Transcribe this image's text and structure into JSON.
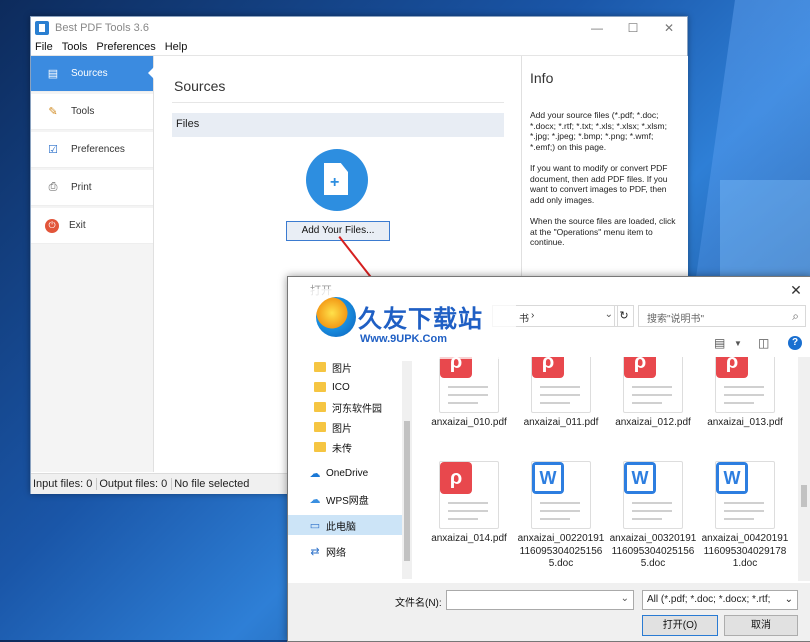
{
  "app": {
    "title": "Best PDF Tools 3.6",
    "menu": [
      "File",
      "Tools",
      "Preferences",
      "Help"
    ],
    "nav": [
      {
        "label": "Sources",
        "icon": "sources-icon"
      },
      {
        "label": "Tools",
        "icon": "tools-icon"
      },
      {
        "label": "Preferences",
        "icon": "preferences-icon"
      },
      {
        "label": "Print",
        "icon": "printer-icon"
      },
      {
        "label": "Exit",
        "icon": "power-icon"
      }
    ],
    "main": {
      "heading": "Sources",
      "files_label": "Files",
      "add_button": "Add Your Files..."
    },
    "info": {
      "title": "Info",
      "p1": "Add your source files (*.pdf; *.doc; *.docx; *.rtf; *.txt; *.xls; *.xlsx; *.xlsm; *.jpg; *.jpeg; *.bmp; *.png; *.wmf; *.emf;) on this page.",
      "p2": "If you want to modify or convert PDF document, then add PDF files. If you want to convert images to PDF, then add only images.",
      "p3": "When the source files are loaded, click at the \"Operations\" menu item to continue."
    },
    "status": {
      "input": "Input files: 0",
      "output": "Output files: 0",
      "selection": "No file selected"
    }
  },
  "dialog": {
    "title": "打开",
    "address": "书",
    "search_placeholder": "搜索\"说明书\"",
    "nav_items": [
      {
        "label": "图片",
        "type": "folder"
      },
      {
        "label": "ICO",
        "type": "folder"
      },
      {
        "label": "河东软件园",
        "type": "folder"
      },
      {
        "label": "图片",
        "type": "folder"
      },
      {
        "label": "未传",
        "type": "folder"
      },
      {
        "label": "OneDrive",
        "type": "cloud"
      },
      {
        "label": "WPS网盘",
        "type": "cloud"
      },
      {
        "label": "此电脑",
        "type": "pc"
      },
      {
        "label": "网络",
        "type": "network"
      }
    ],
    "files": [
      {
        "name": "anxaizai_010.pdf",
        "kind": "pdf"
      },
      {
        "name": "anxaizai_011.pdf",
        "kind": "pdf"
      },
      {
        "name": "anxaizai_012.pdf",
        "kind": "pdf"
      },
      {
        "name": "anxaizai_013.pdf",
        "kind": "pdf"
      },
      {
        "name": "anxaizai_014.pdf",
        "kind": "pdf"
      },
      {
        "name": "anxaizai_00220191116095304025​1565.doc",
        "kind": "doc"
      },
      {
        "name": "anxaizai_00320191116095304025​1565.doc",
        "kind": "doc"
      },
      {
        "name": "anxaizai_00420191116095304029​1781.doc",
        "kind": "doc"
      }
    ],
    "filename_label": "文件名(N):",
    "filename_value": "",
    "filetype": "All (*.pdf; *.doc; *.docx; *.rtf;",
    "open_button": "打开(O)",
    "cancel_button": "取消"
  },
  "watermark": {
    "name": "久友下载站",
    "url": "Www.9UPK.Com",
    "small": "WWW.9UPK.COM"
  }
}
